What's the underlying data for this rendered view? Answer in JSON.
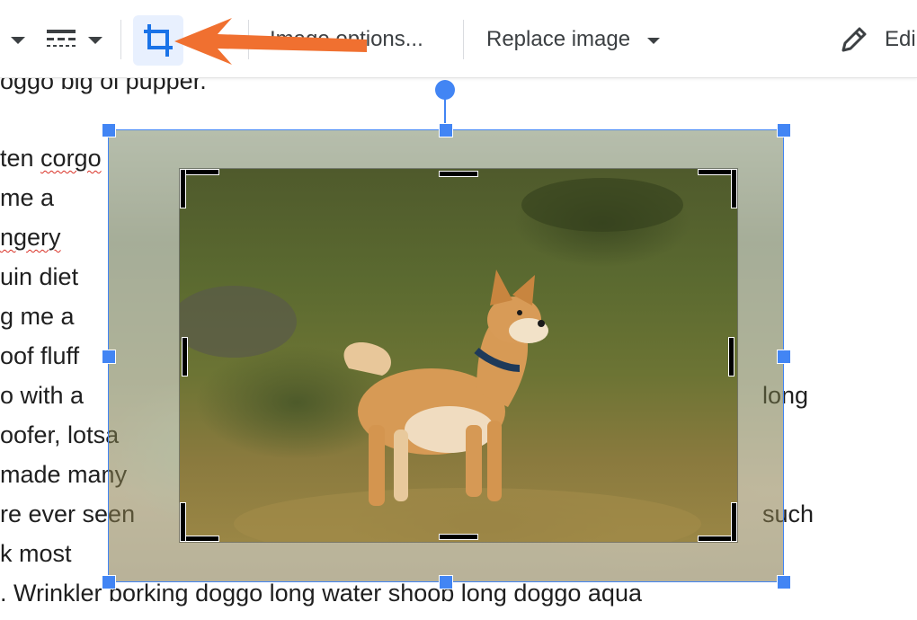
{
  "toolbar": {
    "image_options_label": "Image options...",
    "replace_image_label": "Replace image",
    "edit_label": "Edi",
    "icons": {
      "first_dropdown": "chevron-down-icon",
      "line_style": "dashed-lines-icon",
      "crop": "crop-icon",
      "edit": "pencil-icon"
    },
    "crop_active": true
  },
  "annotation": {
    "arrow_color": "#f07030",
    "points_to": "crop-button"
  },
  "doc_lines": [
    "oggo big ol pupper.",
    "ten corgo",
    "me a",
    "ngery",
    "uin diet",
    "g me a",
    "oof fluff",
    "o with a",
    "oofer, lotsa",
    "made many",
    "re ever seen",
    "k most",
    ". Wrinkler borking doggo long water shoob long doggo aqua"
  ],
  "doc_right": [
    "long",
    "such"
  ],
  "image": {
    "subject": "shiba inu dog standing on grassy hillside",
    "mode": "crop",
    "accent_color": "#4285f4"
  }
}
